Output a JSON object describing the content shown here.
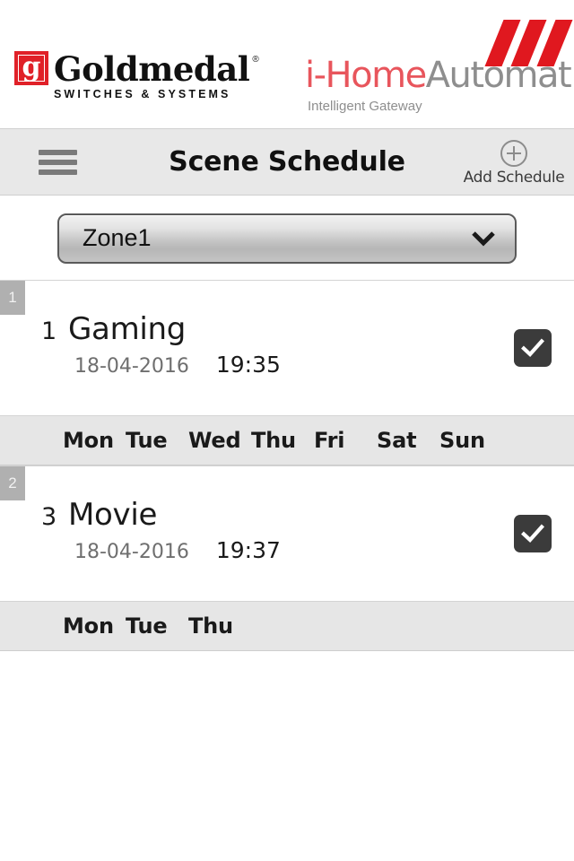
{
  "brand": {
    "goldmedal": {
      "mark_letter": "g",
      "name": "Goldmedal",
      "registered": "®",
      "tagline": "SWITCHES & SYSTEMS",
      "mark_color": "#e02128"
    },
    "ihome": {
      "name_red": "i-Home",
      "name_gray": "Automation",
      "tagline": "Intelligent Gateway",
      "red": "#e8555c",
      "gray": "#8e8e8e",
      "slash_color": "#e0181f"
    }
  },
  "navbar": {
    "menu_icon": "hamburger-icon",
    "title": "Scene Schedule",
    "add_icon": "plus-circle-icon",
    "add_label": "Add Schedule"
  },
  "zone_selector": {
    "selected": "Zone1",
    "chevron_icon": "chevron-down-icon"
  },
  "schedules": [
    {
      "badge": "1",
      "number": "1",
      "name": "Gaming",
      "date": "18-04-2016",
      "time": "19:35",
      "enabled": true,
      "check_icon": "check-icon",
      "days": [
        "Mon",
        "Tue",
        "Wed",
        "Thu",
        "Fri",
        "Sat",
        "Sun"
      ]
    },
    {
      "badge": "2",
      "number": "3",
      "name": "Movie",
      "date": "18-04-2016",
      "time": "19:37",
      "enabled": true,
      "check_icon": "check-icon",
      "days": [
        "Mon",
        "Tue",
        "Thu"
      ]
    }
  ],
  "colors": {
    "navbar_bg": "#e8e8e8",
    "days_bg": "#e6e6e6",
    "checkbox_bg": "#3b3b3b",
    "badge_bg": "#b0b0b0"
  }
}
